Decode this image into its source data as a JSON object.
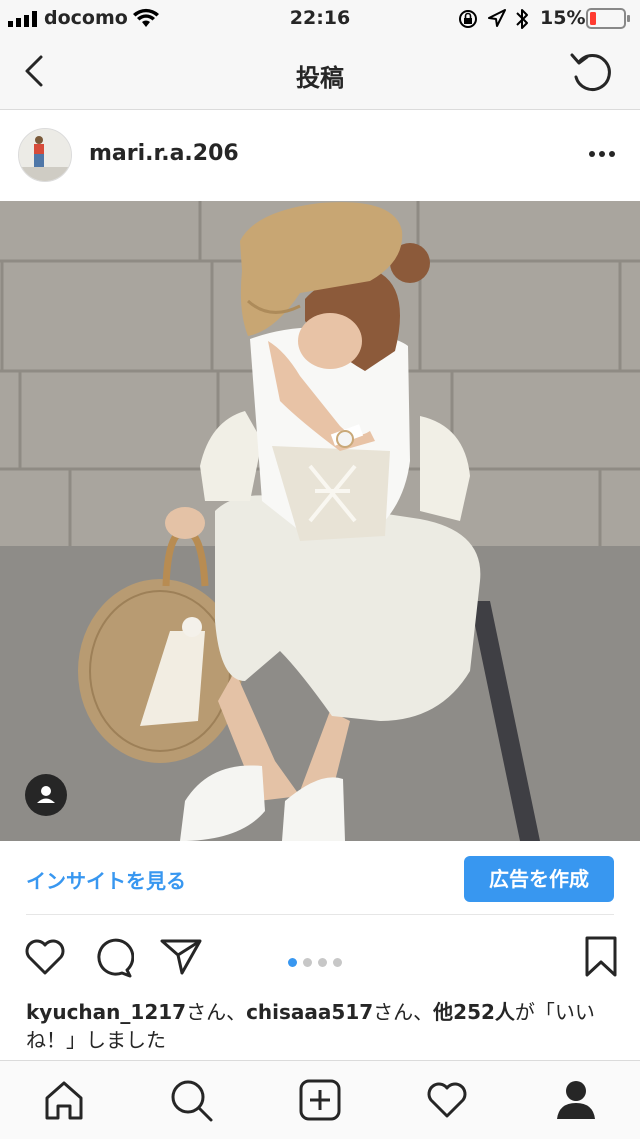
{
  "status_bar": {
    "carrier": "docomo",
    "time": "22:16",
    "battery": "15%"
  },
  "nav": {
    "title": "投稿",
    "back_icon": "chevron-left-icon",
    "refresh_icon": "refresh-icon"
  },
  "post": {
    "username": "mari.r.a.206",
    "insights_label": "インサイトを見る",
    "create_ad_label": "広告を作成",
    "carousel_count": 4,
    "carousel_index": 1,
    "likes": {
      "user1": "kyuchan_1217",
      "suffix1": "さん、",
      "user2": "chisaaa517",
      "suffix2": "さん、",
      "others": "他252人",
      "tail": "が「いいね！」しました"
    }
  },
  "tab_bar": {
    "items": [
      "home-icon",
      "search-icon",
      "add-post-icon",
      "activity-heart-icon",
      "profile-icon"
    ]
  },
  "colors": {
    "accent": "#3897f0",
    "battery_low": "#ff3b30",
    "text": "#262626"
  }
}
